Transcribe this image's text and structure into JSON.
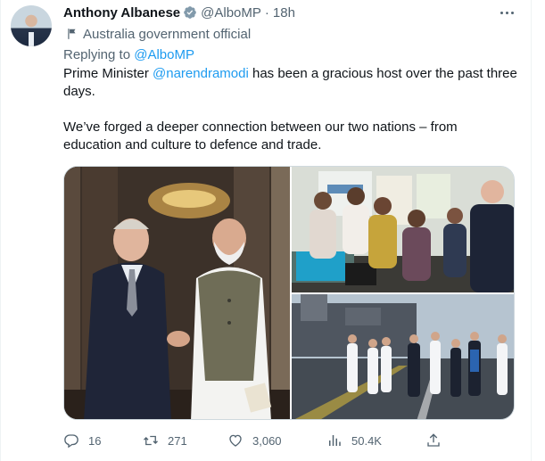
{
  "author": {
    "name": "Anthony Albanese",
    "handle": "@AlboMP",
    "separator": "·",
    "time": "18h",
    "label": "Australia government official"
  },
  "reply": {
    "prefix": "Replying to ",
    "to": "@AlboMP"
  },
  "body": {
    "p1_before": "Prime Minister ",
    "p1_mention": "@narendramodi",
    "p1_after": " has been a gracious host over the past three days.",
    "p2": "We’ve forged a deeper connection between our two nations – from education and culture to defence and trade."
  },
  "media": {
    "images": [
      "handshake-photo",
      "exhibition-photo",
      "aircraft-carrier-photo"
    ]
  },
  "stats": {
    "replies": "16",
    "retweets": "271",
    "likes": "3,060",
    "views": "50.4K"
  },
  "icons": [
    "verified-icon",
    "flag-icon",
    "more-icon",
    "reply-icon",
    "retweet-icon",
    "like-icon",
    "views-icon",
    "share-icon"
  ],
  "colors": {
    "accent": "#1d9bf0",
    "muted": "#536471",
    "text": "#0f1419",
    "border": "#cfd9de"
  }
}
